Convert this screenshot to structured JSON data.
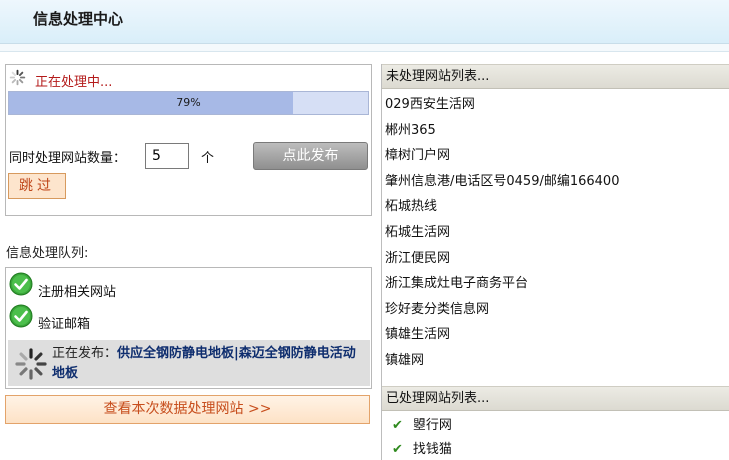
{
  "header": {
    "title": "信息处理中心"
  },
  "processing": {
    "status": "正在处理中...",
    "progress_percent": 79,
    "progress_label": "79%",
    "concurrency_label": "同时处理网站数量：",
    "concurrency_value": "5",
    "unit": "个",
    "publish_button": "点此发布",
    "skip_button": "跳过"
  },
  "queue": {
    "title": "信息处理队列:",
    "done_steps": [
      "注册相关网站",
      "验证邮箱"
    ],
    "current_prefix": "正在发布：",
    "current_name": "供应全钢防静电地板|森迈全钢防静电活动地板"
  },
  "view_button": "查看本次数据处理网站 >>",
  "pending": {
    "title": "未处理网站列表...",
    "sites": [
      "029西安生活网",
      "郴州365",
      "樟树门户网",
      "肇州信息港/电话区号0459/邮编166400",
      "柘城热线",
      "柘城生活网",
      "浙江便民网",
      "浙江集成灶电子商务平台",
      "珍好麦分类信息网",
      "镇雄生活网",
      "镇雄网"
    ]
  },
  "done": {
    "title": "已处理网站列表...",
    "sites": [
      "曌行网",
      "找钱猫"
    ]
  },
  "colors": {
    "status_red": "#b41b1b",
    "progress_fill": "#a7b9e6",
    "check_green": "#2f8a1e",
    "link_navy": "#0e2d6e"
  }
}
